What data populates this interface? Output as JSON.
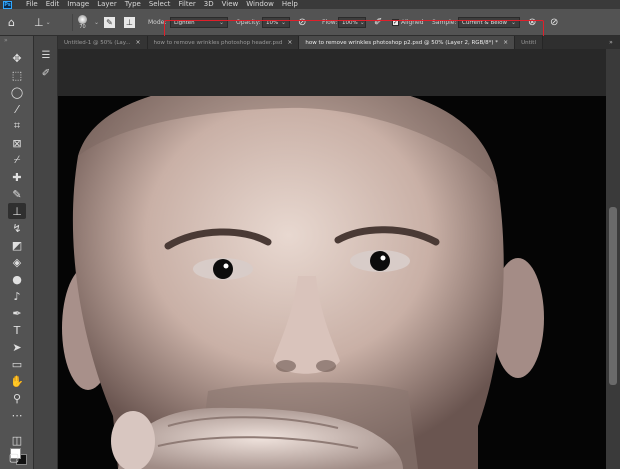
{
  "menu": {
    "logo": "Ps",
    "items": [
      "File",
      "Edit",
      "Image",
      "Layer",
      "Type",
      "Select",
      "Filter",
      "3D",
      "View",
      "Window",
      "Help"
    ]
  },
  "options": {
    "brush_size": "70",
    "mode_label": "Mode:",
    "mode_value": "Lighten",
    "opacity_label": "Opacity:",
    "opacity_value": "10%",
    "flow_label": "Flow:",
    "flow_value": "100%",
    "aligned_label": "Aligned",
    "aligned_checked": "✓",
    "sample_label": "Sample:",
    "sample_value": "Current & Below"
  },
  "tabs": [
    {
      "label": "Untitled-1 @ 50% (Lay...",
      "close": "×"
    },
    {
      "label": "how to remove wrinkles photoshop header.psd",
      "close": "×"
    },
    {
      "label": "how to remove wrinkles photoshop p2.psd @ 50% (Layer 2, RGB/8*) *",
      "close": "×"
    },
    {
      "label": "Untitl",
      "close": ""
    }
  ],
  "tab_overflow": "»",
  "colors": {
    "highlight": "#e01f2a",
    "ui_dark": "#535353",
    "canvas_bg": "#282828"
  }
}
